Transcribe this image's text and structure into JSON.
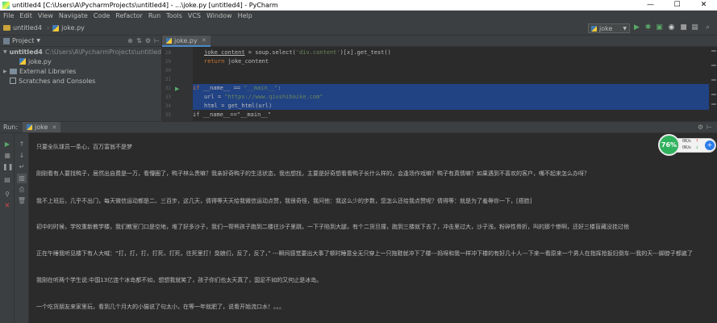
{
  "window": {
    "title": "untitled4 [C:\\Users\\A\\PycharmProjects\\untitled4] - ...\\joke.py [untitled4] - PyCharm",
    "minimize": "—",
    "maximize": "☐",
    "close": "✕"
  },
  "menu": [
    "File",
    "Edit",
    "View",
    "Navigate",
    "Code",
    "Refactor",
    "Run",
    "Tools",
    "VCS",
    "Window",
    "Help"
  ],
  "navbar": {
    "project": "untitled4",
    "file": "joke.py",
    "run_config": "joke"
  },
  "project_panel": {
    "title": "Project",
    "root_name": "untitled4",
    "root_path": "C:\\Users\\A\\PycharmProjects\\untitled4",
    "file": "joke.py",
    "external_libraries": "External Libraries",
    "scratches": "Scratches and Consoles"
  },
  "editor": {
    "tab": "joke.py",
    "line_numbers": [
      "28",
      "29",
      "30",
      "31",
      "32",
      "33",
      "34",
      "35"
    ],
    "lines": {
      "l1_a": "joke_content",
      "l1_b": " = soup.select(",
      "l1_c": "'div.content'",
      "l1_d": ")[x].get_test()",
      "l2_kw": "return",
      "l2_b": " joke_content",
      "l5_kw": "if",
      "l5_b": " __name__ == ",
      "l5_c": "\"__main__\"",
      "l5_d": ":",
      "l6_a": "url = ",
      "l6_b": "\"https://www.qiushibaike.com\"",
      "l7_a": "html = get_html(url)"
    },
    "breadcrumb": "if __name__==\"__main__\""
  },
  "run_panel": {
    "label": "Run:",
    "tab": "joke",
    "output": [
      "只要全队球员一条心，百万富翁不是梦",
      "刚刚看有人要找鸭子，居然出自费是一万，看懵圈了，鸭子林么贵嘛？我亲好奇鸭子的生活状态，我也想找，主要是好奇想看看鸭子长什么样的，会逢场作戏嘛？鸭子有真情嘛？如果遇到不喜欢的客户，嘴不起来怎么办呀？",
      "我不上班后，几乎不出门，每天微信运动都是二、三百步，这几天，倩得等天天给我微信运动点赞，我很奇怪，我问他：我这么少的步数，您怎么还给我点赞呢？倩得等：就是为了羞辱你一下，[捂脸]",
      "初中的时候，学校重新教学楼，我们教室门口是空地，堆了好多沙子，我们一帮熊孩子跑到二楼往沙子里跳，一下子陷到大腿，有个二货旦撞，跑到三楼就下去了，冲击里过大，沙子浅，粉碎性骨折，叫的那个惨啊，还好三楼盲藏没挂过他",
      "正在午睡我听见楼下有人大喊：“打，打，打，打死，打死，往死里打！臭娘们，反了，反了，” ---瞬间感觉要出大事了顿时睡意全无只穿上一只拖鞋就冲下了楼---妈呀和我一样冲下楼的有好几十人---下来一看原来一个男人在指挥抢扳妇倒车---我的天---脚脖子都崴了",
      "我刚在听两个学生说:中国13亿连个冰岛都不如，想想我就笑了，孩子你们也太天真了，国足不如的又何止是冰岛。",
      "一个吃货朋友来家里玩，看到几个月大的小猫说了句太小，在等一年就肥了，说看开始流口水！。。。"
    ]
  },
  "speed_widget": {
    "percent": "76%",
    "up": "0K/s",
    "down": "0K/s",
    "up_arrow": "↑",
    "down_arrow": "↓",
    "plus": "+"
  },
  "colors": {
    "accent": "#4a88c7",
    "selection": "#214283",
    "run_green": "#59a869",
    "gauge_green": "#2fb15d"
  }
}
